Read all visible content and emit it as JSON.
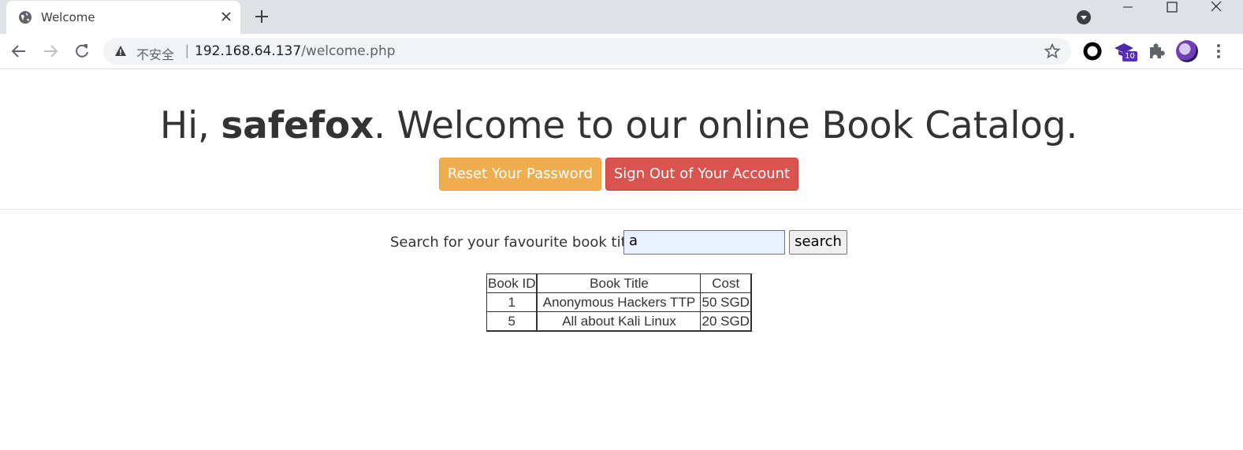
{
  "browser": {
    "tab_title": "Welcome",
    "insecure_label": "不安全",
    "separator": "|",
    "url_host": "192.168.64.137",
    "url_path": "/welcome.php",
    "extension_badge": "10",
    "icons": [
      "globe-icon",
      "close-icon",
      "plus-icon",
      "tab-search-icon",
      "minimize-icon",
      "maximize-icon",
      "window-close-icon",
      "back-icon",
      "forward-icon",
      "reload-icon",
      "warning-icon",
      "star-icon",
      "ring-extension-icon",
      "graduation-cap-extension-icon",
      "puzzle-icon",
      "more-icon"
    ]
  },
  "page": {
    "greeting_prefix": "Hi, ",
    "username": "safefox",
    "greeting_suffix": ". Welcome to our online Book Catalog.",
    "reset_button": "Reset Your Password",
    "signout_button": "Sign Out of Your Account",
    "search_label": "Search for your favourite book title",
    "search_value": "a",
    "search_button": "search",
    "colors": {
      "warning": "#f0ad4e",
      "danger": "#d9534f",
      "input_bg": "#e8f0fe"
    },
    "table": {
      "headers": [
        "Book ID",
        "Book Title",
        "Cost"
      ],
      "rows": [
        [
          "1",
          "Anonymous Hackers TTP",
          "50 SGD"
        ],
        [
          "5",
          "All about Kali Linux",
          "20 SGD"
        ]
      ]
    }
  }
}
